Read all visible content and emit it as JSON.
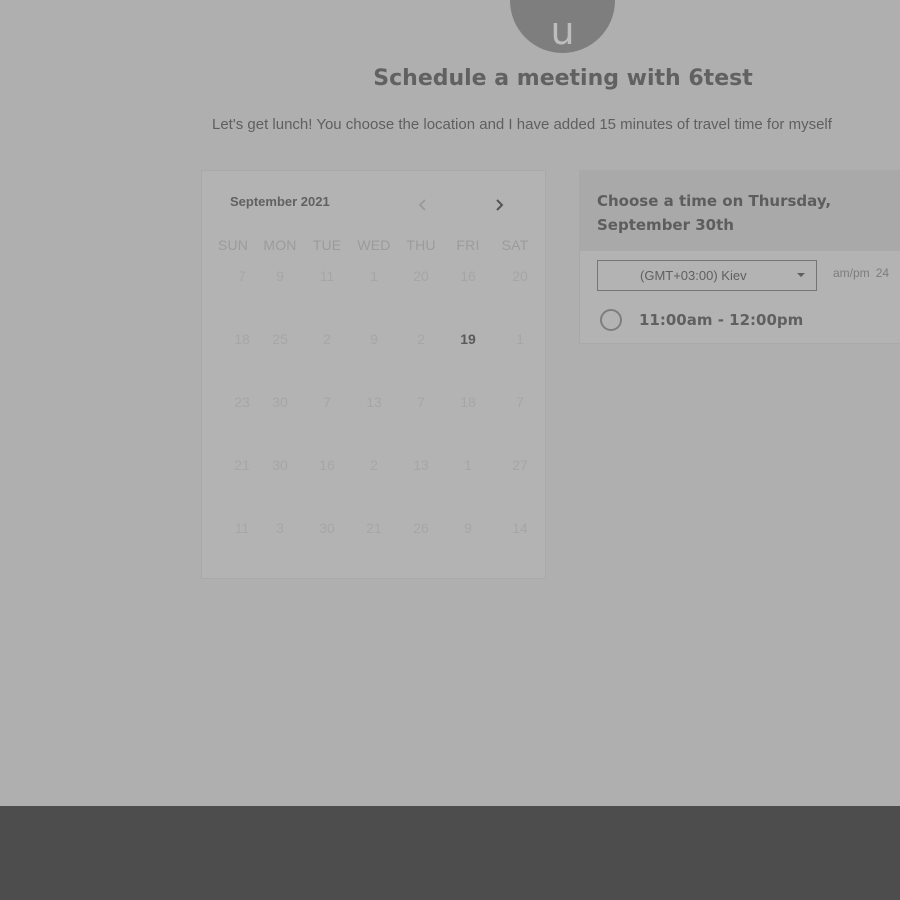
{
  "header": {
    "avatar_letter": "u",
    "title": "Schedule a meeting with 6test",
    "description": "Let's get lunch! You choose the location and I have added 15 minutes of travel time for myself"
  },
  "calendar": {
    "month_label": "September 2021",
    "prev_icon": "chevron-left-icon",
    "next_icon": "chevron-right-icon",
    "weekdays": [
      "SUN",
      "MON",
      "TUE",
      "WED",
      "THU",
      "FRI",
      "SAT"
    ],
    "weeks": [
      [
        "7",
        "9",
        "11",
        "1",
        "20",
        "16",
        "20"
      ],
      [
        "18",
        "25",
        "2",
        "9",
        "2",
        "19",
        "1"
      ],
      [
        "23",
        "30",
        "7",
        "13",
        "7",
        "18",
        "7"
      ],
      [
        "21",
        "30",
        "16",
        "2",
        "13",
        "1",
        "27"
      ],
      [
        "11",
        "3",
        "30",
        "21",
        "26",
        "9",
        "14"
      ]
    ],
    "available_day": "19"
  },
  "time_panel": {
    "heading": "Choose a time on Thursday, September 30th",
    "timezone": "(GMT+03:00) Kiev",
    "format_12": "am/pm",
    "format_24": "24",
    "slots": [
      "11:00am - 12:00pm"
    ]
  },
  "colors": {
    "overlay_background": "#afafaf",
    "footer_bar": "#4d4d4d",
    "avatar": "#7e7e7e"
  }
}
